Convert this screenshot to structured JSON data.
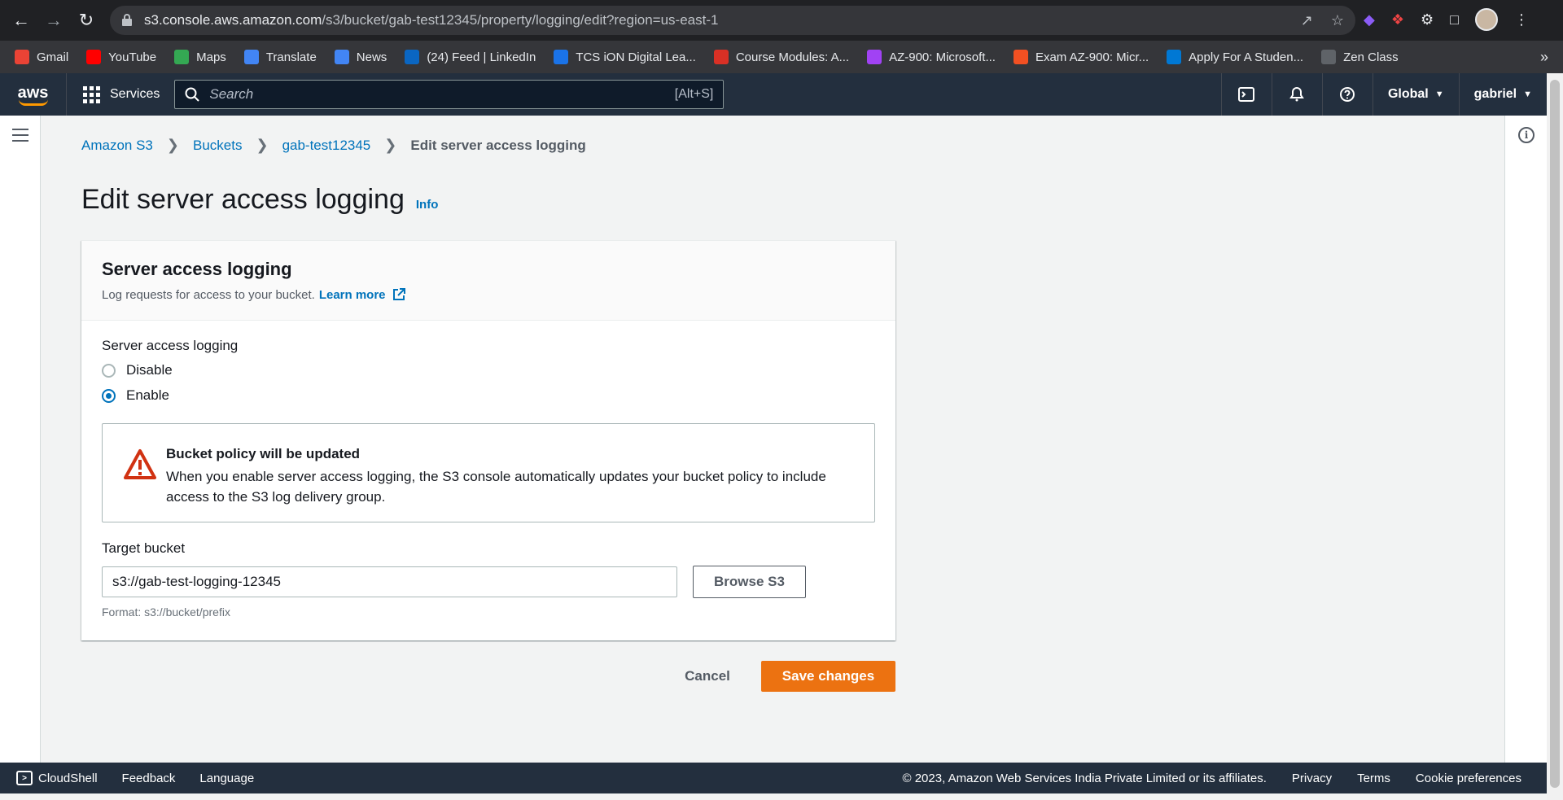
{
  "browser": {
    "url_host": "s3.console.aws.amazon.com",
    "url_path": "/s3/bucket/gab-test12345/property/logging/edit?region=us-east-1",
    "bookmarks": [
      {
        "label": "Gmail",
        "icon": "gmail-icon",
        "color": "#ea4335"
      },
      {
        "label": "YouTube",
        "icon": "youtube-icon",
        "color": "#ff0000"
      },
      {
        "label": "Maps",
        "icon": "maps-icon",
        "color": "#34a853"
      },
      {
        "label": "Translate",
        "icon": "translate-icon",
        "color": "#4285f4"
      },
      {
        "label": "News",
        "icon": "news-icon",
        "color": "#4285f4"
      },
      {
        "label": "(24) Feed | LinkedIn",
        "icon": "linkedin-icon",
        "color": "#0a66c2"
      },
      {
        "label": "TCS iON Digital Lea...",
        "icon": "tcs-icon",
        "color": "#1a73e8"
      },
      {
        "label": "Course Modules: A...",
        "icon": "course-icon",
        "color": "#d93025"
      },
      {
        "label": "AZ-900: Microsoft...",
        "icon": "az900-icon",
        "color": "#a142f4"
      },
      {
        "label": "Exam AZ-900: Micr...",
        "icon": "microsoft-icon",
        "color": "#f25022"
      },
      {
        "label": "Apply For A Studen...",
        "icon": "azure-icon",
        "color": "#0078d4"
      },
      {
        "label": "Zen Class",
        "icon": "zen-icon",
        "color": "#5f6368"
      }
    ],
    "more": "»"
  },
  "aws_nav": {
    "logo": "aws",
    "services_label": "Services",
    "search_placeholder": "Search",
    "search_shortcut": "[Alt+S]",
    "region_label": "Global",
    "user_label": "gabriel"
  },
  "breadcrumb": {
    "items": [
      "Amazon S3",
      "Buckets",
      "gab-test12345"
    ],
    "current": "Edit server access logging"
  },
  "page": {
    "title": "Edit server access logging",
    "info_label": "Info"
  },
  "panel": {
    "title": "Server access logging",
    "description": "Log requests for access to your bucket.",
    "learn_more": "Learn more",
    "field_label": "Server access logging",
    "options": [
      {
        "label": "Disable",
        "checked": false
      },
      {
        "label": "Enable",
        "checked": true
      }
    ],
    "alert": {
      "title": "Bucket policy will be updated",
      "body": "When you enable server access logging, the S3 console automatically updates your bucket policy to include access to the S3 log delivery group.",
      "color": "#d13212"
    },
    "target_label": "Target bucket",
    "target_value": "s3://gab-test-logging-12345",
    "browse_label": "Browse S3",
    "format_hint": "Format: s3://bucket/prefix"
  },
  "actions": {
    "cancel": "Cancel",
    "save": "Save changes",
    "save_color": "#ec7211"
  },
  "footer": {
    "cloudshell": "CloudShell",
    "feedback": "Feedback",
    "language": "Language",
    "copyright": "© 2023, Amazon Web Services India Private Limited or its affiliates.",
    "privacy": "Privacy",
    "terms": "Terms",
    "cookies": "Cookie preferences"
  }
}
